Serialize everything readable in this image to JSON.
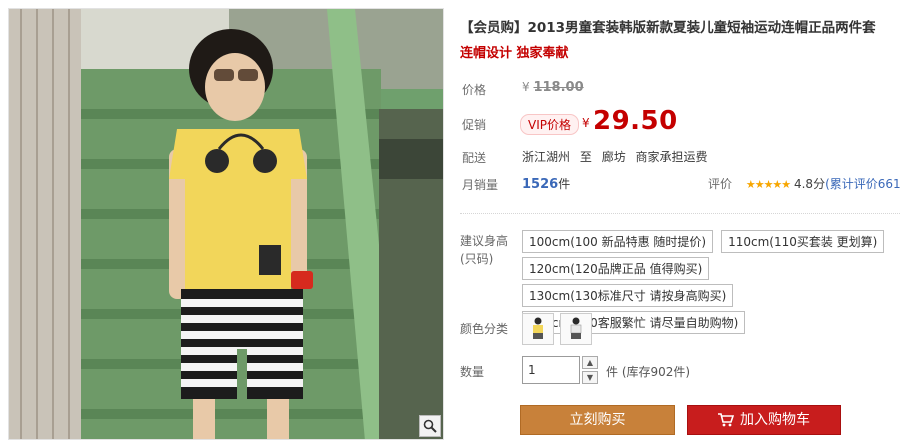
{
  "product": {
    "title": "【会员购】2013男童套装韩版新款夏装儿童短袖运动连帽正品两件套",
    "subtitle": "连帽设计 独家奉献"
  },
  "price": {
    "label": "价格",
    "currency": "¥",
    "original": "118.00"
  },
  "promo": {
    "label": "促销",
    "tag": "VIP价格",
    "currency": "¥",
    "price": "29.50"
  },
  "shipping": {
    "label": "配送",
    "from": "浙江湖州",
    "to_word": "至",
    "to": "廊坊",
    "fee": "商家承担运费"
  },
  "sales": {
    "label": "月销量",
    "count": "1526",
    "unit": "件"
  },
  "rating": {
    "label": "评价",
    "stars": "★★★★★",
    "score": "4.8分",
    "reviews": "(累计评价661"
  },
  "size": {
    "label": "建议身高(只码)",
    "options": [
      "100cm(100 新品特惠 随时提价)",
      "110cm(110买套装 更划算)",
      "120cm(120品牌正品 值得购买)",
      "130cm(130标准尺寸 请按身高购买)",
      "140cm(140客服繁忙 请尽量自助购物)"
    ]
  },
  "color": {
    "label": "颜色分类",
    "swatch_count": 2
  },
  "quantity": {
    "label": "数量",
    "value": "1",
    "stock": "件 (库存902件)"
  },
  "actions": {
    "buy_now": "立刻购买",
    "add_to_cart": "加入购物车"
  },
  "colors": {
    "price_red": "#c40000",
    "buy_button": "#c8813a",
    "cart_button": "#c81d1d",
    "sales_blue": "#3a68b8",
    "star": "#f7a600"
  }
}
